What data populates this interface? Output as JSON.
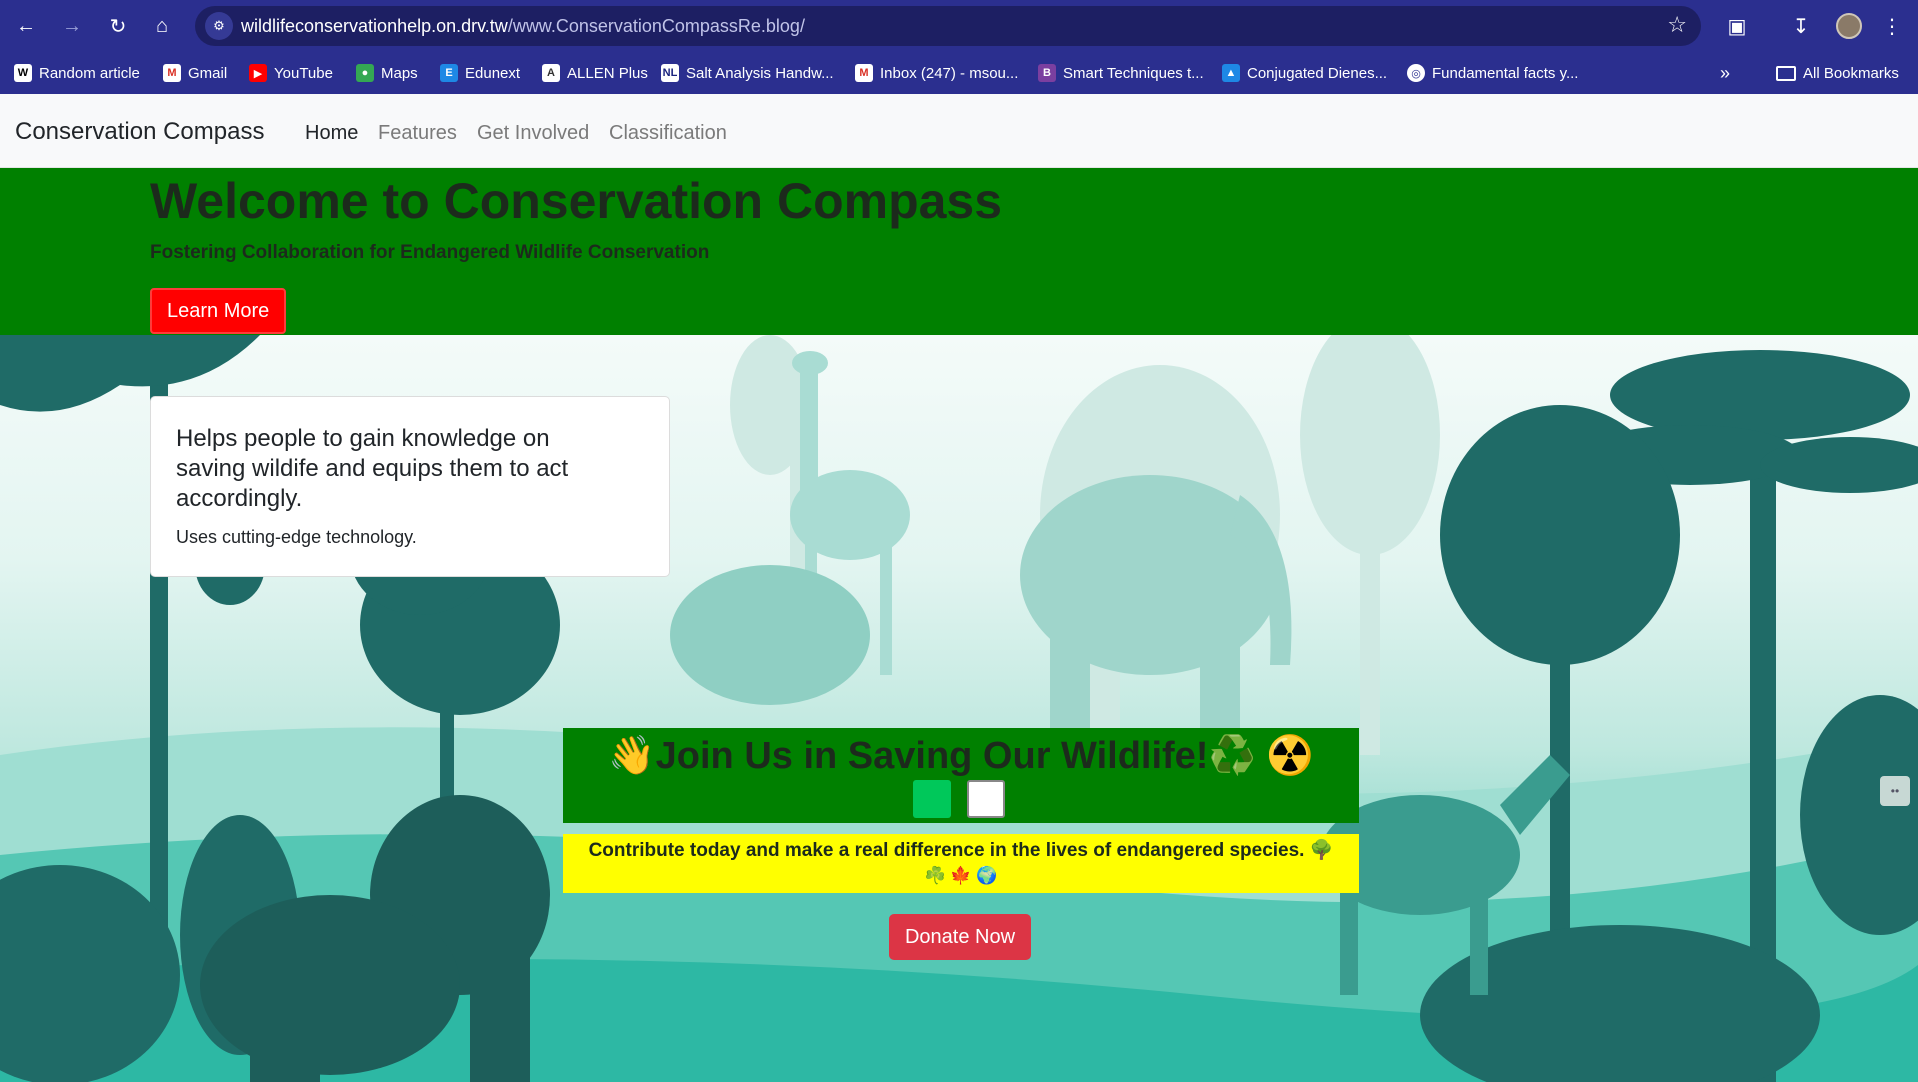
{
  "browser": {
    "url_host": "wildlifeconservationhelp.on.drv.tw",
    "url_path": "/www.ConservationCompassRe.blog/",
    "bookmarks": [
      {
        "label": "Random article",
        "icon": "wikipedia-icon"
      },
      {
        "label": "Gmail",
        "icon": "gmail-icon"
      },
      {
        "label": "YouTube",
        "icon": "youtube-icon"
      },
      {
        "label": "Maps",
        "icon": "maps-icon"
      },
      {
        "label": "Edunext",
        "icon": "edunext-icon"
      },
      {
        "label": "ALLEN Plus",
        "icon": "allen-icon"
      },
      {
        "label": "Salt Analysis Handw...",
        "icon": "nl-icon"
      },
      {
        "label": "Inbox (247) - msou...",
        "icon": "gmail-icon"
      },
      {
        "label": "Smart Techniques t...",
        "icon": "bookmark-icon"
      },
      {
        "label": "Conjugated Dienes...",
        "icon": "flask-icon"
      },
      {
        "label": "Fundamental facts y...",
        "icon": "globe-icon"
      }
    ],
    "all_bookmarks": "All Bookmarks"
  },
  "navbar": {
    "brand": "Conservation Compass",
    "links": [
      "Home",
      "Features",
      "Get Involved",
      "Classification"
    ]
  },
  "hero": {
    "title": "Welcome to Conservation Compass",
    "subtitle": "Fostering Collaboration for Endangered Wildlife Conservation",
    "button": "Learn More"
  },
  "card": {
    "text": "Helps people to gain knowledge on saving wildife and equips them to act accordingly.",
    "subtext": "Uses cutting-edge technology."
  },
  "join": {
    "title": "👋Join Us in Saving Our Wildlife!♻️ ☢️"
  },
  "contribute": {
    "line1": "Contribute today and make a real difference in the lives of endangered species. 🌳",
    "line2": "☘️ 🍁 🌍"
  },
  "donate": {
    "button": "Donate Now"
  },
  "colors": {
    "chrome": "#2b2f8f",
    "hero_bg": "#008000",
    "learn_button": "#ff0000",
    "donate_button": "#dc3545",
    "yellow_box": "#ffff00"
  }
}
